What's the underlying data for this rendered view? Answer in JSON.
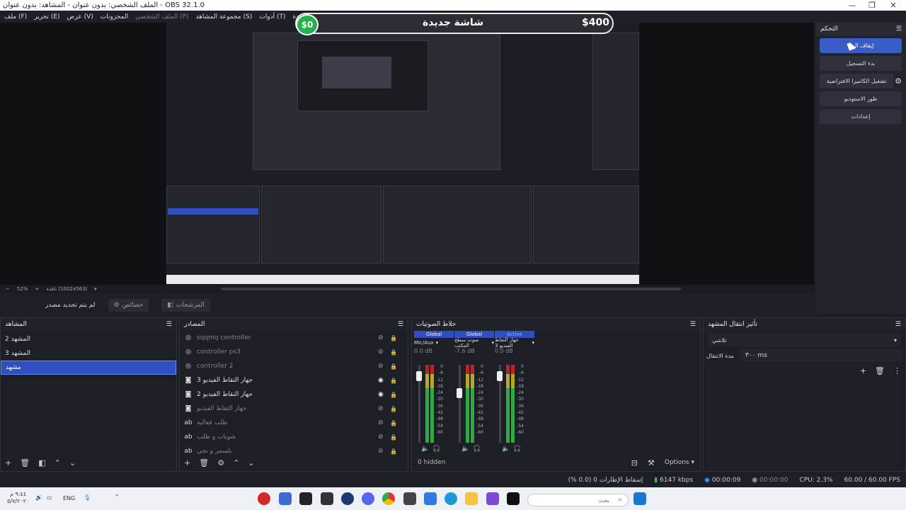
{
  "window": {
    "title": "OBS 32.1.0 - الملف الشخصي: بدون عنوان - المشاهد: بدون عنوان",
    "minimize": "—",
    "maximize": "❐",
    "close": "✕"
  },
  "menu": [
    {
      "label": "ملف (F)"
    },
    {
      "label": "تحرير (E)"
    },
    {
      "label": "عرض (V)"
    },
    {
      "label": "المحزونات"
    },
    {
      "label": "الملف الشخصي (P)",
      "dim": true
    },
    {
      "label": "مجموعة المشاهد (S)"
    },
    {
      "label": "أدوات (T)"
    },
    {
      "label": "مساعدة (H)"
    }
  ],
  "overlay": {
    "left_amount": "$0",
    "title": "شاشة جديدة",
    "right_amount": "$400"
  },
  "controls": {
    "title": "التحكم",
    "buttons": [
      "إيقاف البث",
      "بدء التسجيل",
      "تشغيل الكاميرا الافتراضية",
      "طور الاستوديو",
      "إعدادات"
    ]
  },
  "zoom": {
    "level": "52%",
    "resolution": "نافذة (1002x563)"
  },
  "source_toolbar": {
    "no_source": "لم يتم تحديد مصدر",
    "properties": "خصائص",
    "filters": "المرشحات"
  },
  "scenes": {
    "title": "المشاهد",
    "items": [
      {
        "label": "المشهد 2",
        "selected": false
      },
      {
        "label": "المشهد 3",
        "selected": false
      },
      {
        "label": "مشهد",
        "selected": true
      }
    ]
  },
  "sources": {
    "title": "المصادر",
    "items": [
      {
        "icon": "gamepad",
        "label": "sqqmq controller",
        "visible": false,
        "dim": true
      },
      {
        "icon": "gamepad",
        "label": "controller ps3",
        "visible": false,
        "dim": true
      },
      {
        "icon": "gamepad",
        "label": "controller 2",
        "visible": false,
        "dim": true
      },
      {
        "icon": "camera",
        "label": "جهاز التقاط الفيديو 3",
        "visible": true,
        "dim": false
      },
      {
        "icon": "camera",
        "label": "جهاز التقاط الفيديو 2",
        "visible": true,
        "dim": false
      },
      {
        "icon": "camera",
        "label": "جهاز التقاط الفيديو",
        "visible": false,
        "dim": true
      },
      {
        "icon": "text",
        "label": "طلب فعالية",
        "visible": false,
        "dim": true
      },
      {
        "icon": "text",
        "label": "شوبات و طلب",
        "visible": false,
        "dim": true
      },
      {
        "icon": "text",
        "label": "بلسمر و نجي",
        "visible": false,
        "dim": true
      }
    ]
  },
  "mixer": {
    "title": "خلاط الصوتيات",
    "channels": [
      {
        "scope": "Global",
        "name": "Mic/Aux",
        "db": "0.0 dB",
        "fader": 0.08,
        "active": false
      },
      {
        "scope": "Global",
        "name": "صوت سطح المكتب",
        "db": "-7.6 dB",
        "fader": 0.3,
        "active": false
      },
      {
        "scope": "Active",
        "name": "جهاز التقاط الفيديو 3",
        "db": "0.0 dB",
        "fader": 0.08,
        "active": true
      }
    ],
    "scale": [
      "0",
      "-6",
      "-12",
      "-18",
      "-24",
      "-30",
      "-36",
      "-42",
      "-48",
      "-54",
      "-60"
    ],
    "hidden": "0 hidden",
    "options": "Options"
  },
  "transitions": {
    "title": "تأثير انتقال المشهد",
    "type": "تلاشي",
    "duration_label": "مدة الانتقال",
    "duration": "٣٠٠ ms"
  },
  "status": {
    "dropped": "إسقاط الإطارات 0 (0.0 %)",
    "bitrate": "6147 kbps",
    "stream_time": "00:00:09",
    "rec_time": "00:00:00",
    "cpu": "CPU: 2.3%",
    "fps": "60.00 / 60.00 FPS"
  },
  "taskbar": {
    "time": "٩:٤٤ م",
    "date": "٥/٧/٢٠٢٠",
    "lang": "ENG",
    "search": "بحث"
  }
}
